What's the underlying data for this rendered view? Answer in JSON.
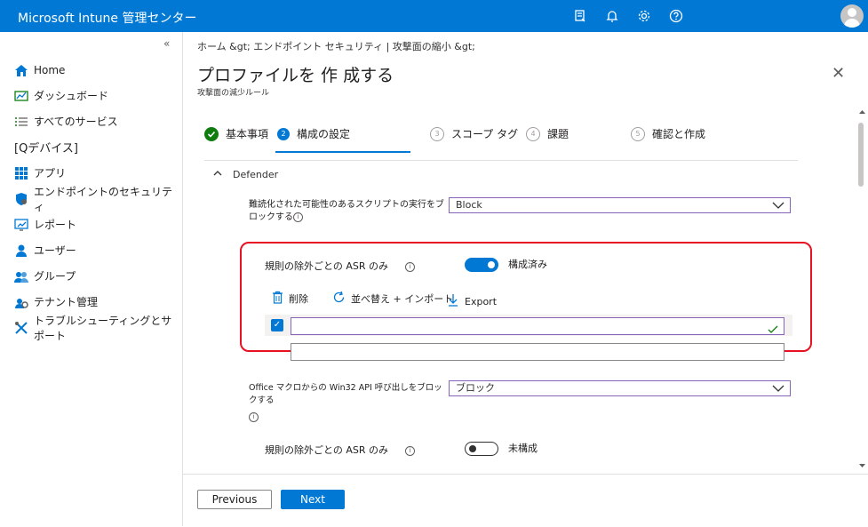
{
  "app": {
    "title": "Microsoft Intune 管理センター"
  },
  "sidebar": {
    "collapse": "«",
    "items": [
      {
        "label": "Home",
        "icon": "home-icon"
      },
      {
        "label": "ダッシュボード",
        "icon": "dashboard-icon"
      },
      {
        "label": "すべてのサービス",
        "icon": "list-icon"
      },
      {
        "label": "[Qデバイス]",
        "icon": ""
      },
      {
        "label": "アプリ",
        "icon": "apps-grid-icon"
      },
      {
        "label": "エンドポイントのセキュリティ",
        "icon": "shield-icon"
      },
      {
        "label": "レポート",
        "icon": "report-icon"
      },
      {
        "label": "ユーザー",
        "icon": "user-icon"
      },
      {
        "label": "グループ",
        "icon": "group-icon"
      },
      {
        "label": "テナント管理",
        "icon": "tenant-gear-icon"
      },
      {
        "label": "トラブルシューティングとサポート",
        "icon": "tools-icon"
      }
    ]
  },
  "header": {
    "breadcrumb": "ホーム &gt; エンドポイント セキュリティ | 攻撃面の縮小 &gt;",
    "title": "プロファイルを 作 成する",
    "subtitle": "攻撃面の減少ルール",
    "close": "✕"
  },
  "steps": [
    {
      "label": "基本事項",
      "num": "",
      "state": "done"
    },
    {
      "label": "構成の設定",
      "num": "2",
      "state": "current"
    },
    {
      "label": "スコープ タグ",
      "num": "3",
      "state": "pending"
    },
    {
      "label": "課題",
      "num": "4",
      "state": "pending"
    },
    {
      "label": "確認と作成",
      "num": "5",
      "state": "pending"
    }
  ],
  "section": {
    "title": "Defender"
  },
  "setting1": {
    "label": "難読化された可能性のあるスクリプトの実行をブ",
    "label2": "ロックする",
    "value": "Block"
  },
  "asr1": {
    "label": "規則の除外ごとの ASR のみ",
    "toggle": "構成済み",
    "delete": "削除",
    "sort": "並べ替え + インポート",
    "export": "Export",
    "check": "✓"
  },
  "setting2": {
    "label": "Office マクロからの  Win32 API 呼び出しをブロックする",
    "value": "ブロック"
  },
  "asr2": {
    "label": "規則の除外ごとの ASR のみ",
    "toggle": "未構成"
  },
  "footer": {
    "previous": "Previous",
    "next": "Next"
  },
  "colors": {
    "accent": "#0078d4",
    "success": "#107c10",
    "highlight": "#e81123"
  }
}
